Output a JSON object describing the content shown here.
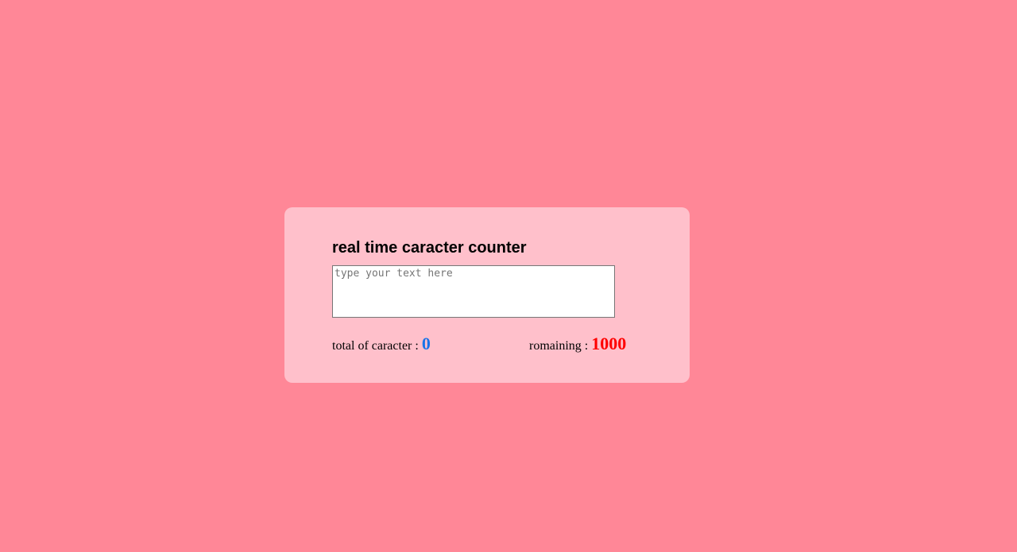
{
  "card": {
    "title": "real time caracter counter",
    "textarea": {
      "placeholder": "type your text here",
      "value": ""
    },
    "total": {
      "label": "total of caracter : ",
      "value": "0",
      "color": "#1a73e8"
    },
    "remaining": {
      "label": "romaining : ",
      "value": "1000",
      "color": "#ff0000"
    }
  },
  "colors": {
    "page_background": "#ff8797",
    "card_background": "#ffc0cb"
  }
}
